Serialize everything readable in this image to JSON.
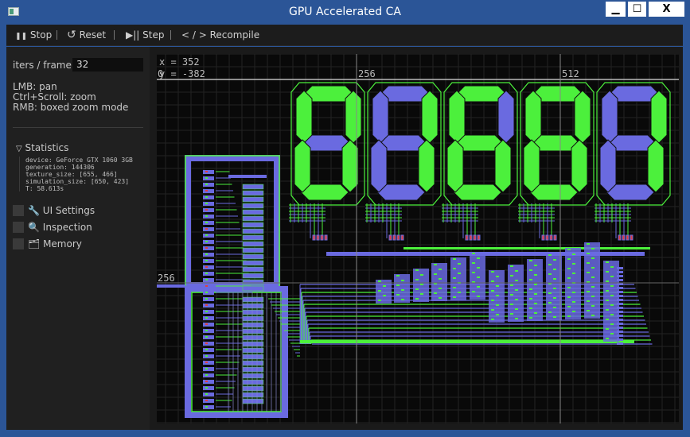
{
  "window": {
    "title": "GPU Accelerated CA",
    "minimize": "▁",
    "maximize": "☐",
    "close": "X"
  },
  "toolbar": {
    "stop": "Stop",
    "reset": "Reset",
    "step": "Step",
    "recompile": "Recompile",
    "stop_icon": "❚❚",
    "reset_icon": "↺",
    "step_icon": "▶||",
    "recompile_icon": "< / >"
  },
  "panel": {
    "iters_label": "iters / frame:",
    "iters_value": "32",
    "help": [
      "LMB: pan",
      "Ctrl+Scroll: zoom",
      "RMB: boxed zoom mode"
    ],
    "statistics": {
      "header": "Statistics",
      "lines": [
        "device: GeForce GTX 1060 3GB",
        "generation: 144306",
        "texture_size: [655, 466]",
        "simulation_size: [650, 423]",
        "T: 58.613s"
      ]
    },
    "sections": [
      "UI Settings",
      "Inspection",
      "Memory"
    ]
  },
  "canvas": {
    "cursor": {
      "x": "x = 352",
      "y": "y = -382"
    },
    "axis_labels": {
      "x1": "256",
      "x2": "512",
      "y_zero": "0",
      "y1": "256"
    },
    "display_digits": "01681",
    "colors": {
      "on": "#4cf03c",
      "off": "#6a6ae0",
      "background": "#090909",
      "grid": "#222222"
    }
  }
}
